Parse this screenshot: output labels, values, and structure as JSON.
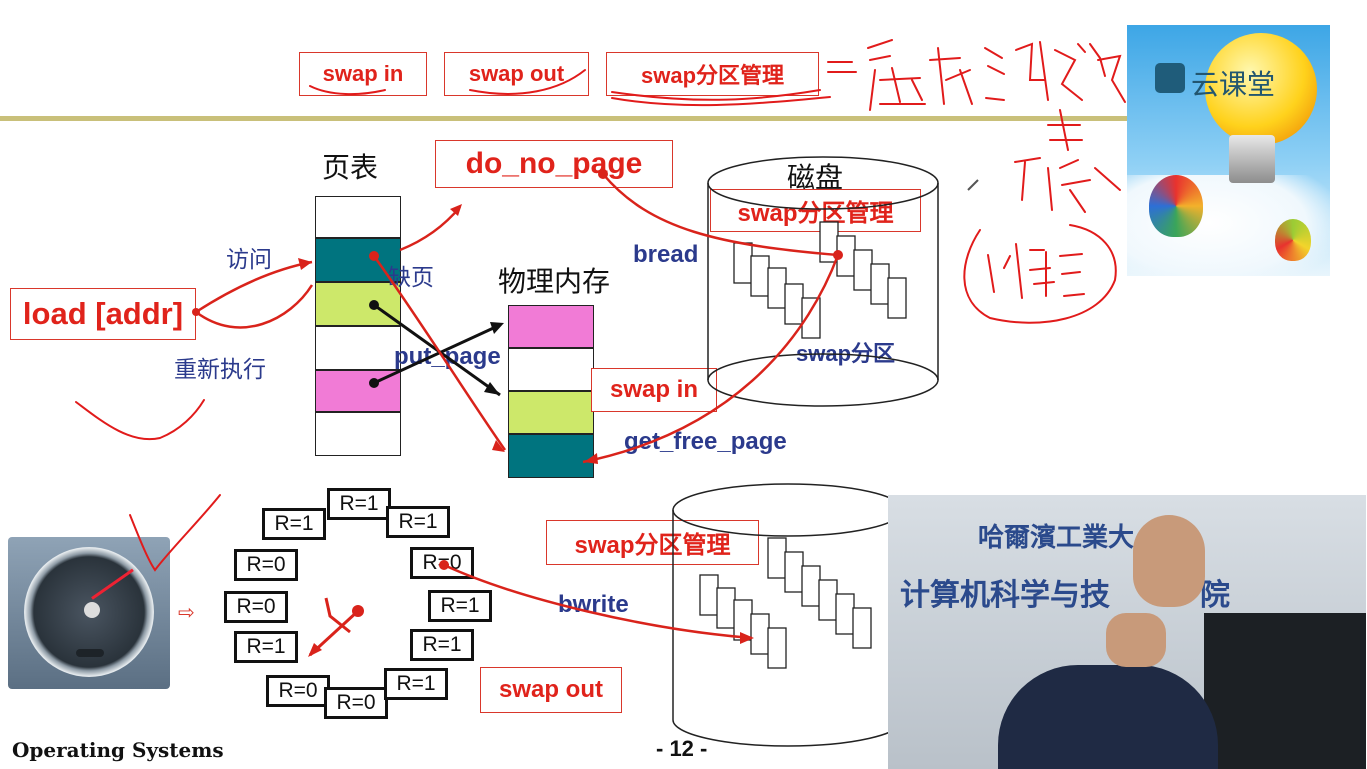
{
  "top_boxes": [
    "swap in",
    "swap out",
    "swap分区管理"
  ],
  "page_table_title": "页表",
  "do_no_page": "do_no_page",
  "disk_title": "磁盘",
  "swap_manage": "swap分区管理",
  "access_label": "访问",
  "page_fault_label": "缺页",
  "load_instr": "load [addr]",
  "reexecute_label": "重新执行",
  "physical_memory_title": "物理内存",
  "bread_label": "bread",
  "put_page_label": "put_page",
  "swap_partition_label": "swap分区",
  "swap_in_label": "swap in",
  "get_free_page_label": "get_free_page",
  "clock_cells": [
    "R=1",
    "R=1",
    "R=1",
    "R=0",
    "R=0",
    "R=0",
    "R=1",
    "R=1",
    "R=1",
    "R=0",
    "R=0",
    "R=1"
  ],
  "swap_manage_bottom": "swap分区管理",
  "bwrite_label": "bwrite",
  "swap_out_label": "swap out",
  "footer_title": "Operating Systems",
  "page_number": "- 12 -",
  "brand_name": "云课堂",
  "video_wall_text": "哈爾濱工業大",
  "video_wall_text2": "计算机科学与技",
  "video_wall_text3": "院"
}
